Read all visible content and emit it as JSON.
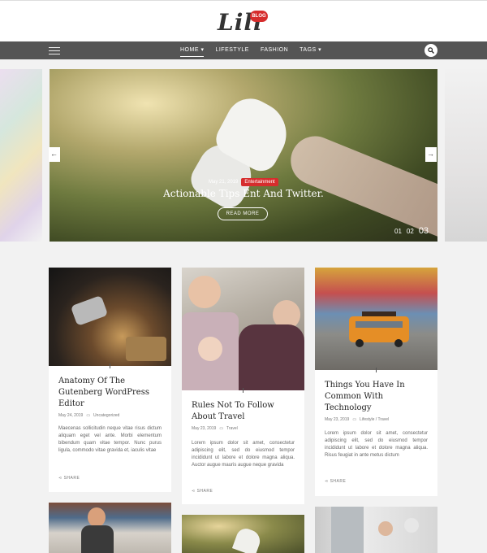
{
  "logo": {
    "text": "Lili",
    "badge": "BLOG"
  },
  "nav": {
    "items": [
      {
        "label": "HOME ▾",
        "active": true
      },
      {
        "label": "LIFESTYLE",
        "active": false
      },
      {
        "label": "FASHION",
        "active": false
      },
      {
        "label": "TAGS ▾",
        "active": false
      }
    ],
    "menu_icon": "hamburger-icon",
    "search_icon": "search-icon"
  },
  "slider": {
    "date": "May 21, 2019",
    "category": "Entertainment",
    "title": "Actionable Tips Ent And Twitter.",
    "button": "READ MORE",
    "pagination": [
      "01",
      "02",
      "03"
    ],
    "prev_icon": "arrow-left-icon",
    "next_icon": "arrow-right-icon",
    "accent": "#d62d2d"
  },
  "posts": [
    {
      "title": "Anatomy Of The Gutenberg WordPress Editor",
      "date": "May 24, 2019",
      "category": "Uncategorized",
      "excerpt": "Maecenas sollicitudin neque vitae risus dictum aliquam eget vel ante. Morbi elementum bibendum quam vitae tempor. Nunc purus ligula, commodo vitae gravida et, iaculis vitae",
      "share": "SHARE"
    },
    {
      "title": "Rules Not To Follow About Travel",
      "date": "May 23, 2019",
      "category": "Travel",
      "excerpt": "Lorem ipsum dolor sit amet, consectetur adipiscing elit, sed do eiusmod tempor incididunt ut labore et dolore magna aliqua. Auctor augue mauris augue neque gravida",
      "share": "SHARE"
    },
    {
      "title": "Things You Have In Common With Technology",
      "date": "May 23, 2019",
      "category": "Lifestyle / Travel",
      "excerpt": "Lorem ipsum dolor sit amet, consectetur adipiscing elit, sed do eiusmod tempor incididunt ut labore et dolore magna aliqua. Risus feugiat in ante metus dictum",
      "share": "SHARE"
    }
  ]
}
